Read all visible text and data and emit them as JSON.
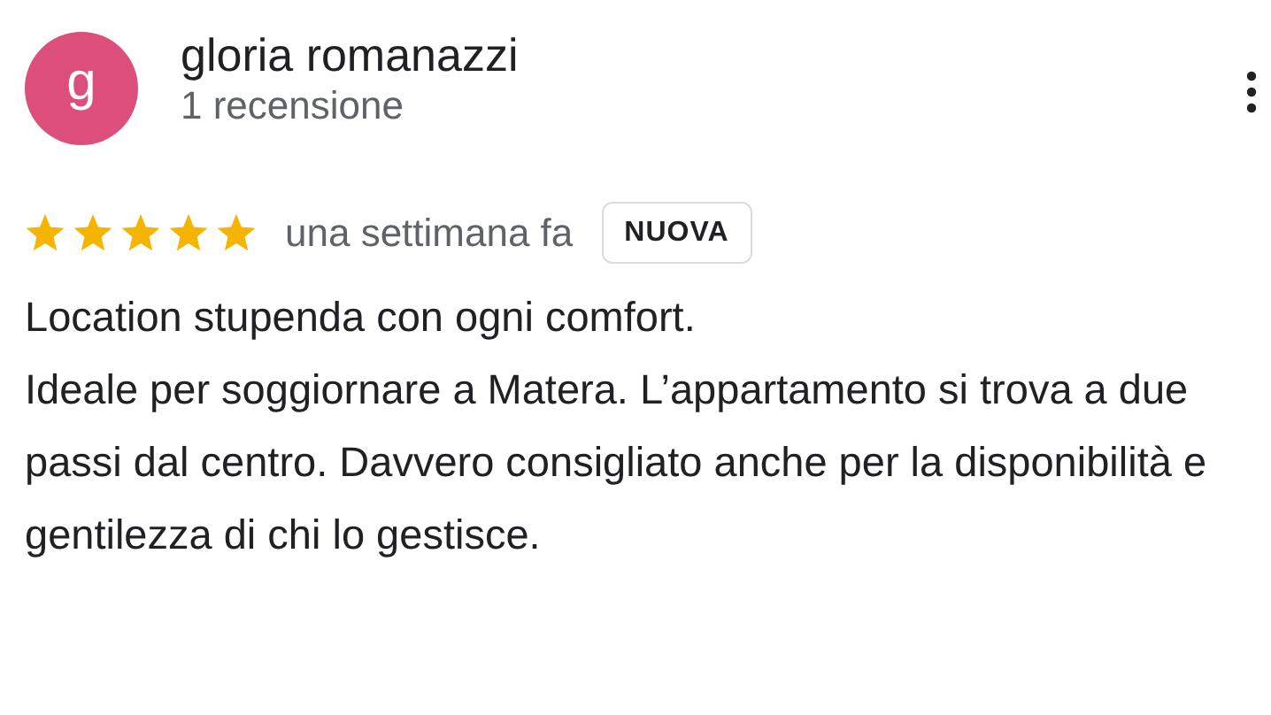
{
  "reviewer": {
    "avatar_letter": "g",
    "name": "gloria romanazzi",
    "review_count": "1 recensione"
  },
  "review": {
    "stars": 5,
    "date": "una settimana fa",
    "badge": "NUOVA",
    "text": "Location stupenda con ogni comfort.\nIdeale per soggiornare a Matera. L’appartamento si trova a due passi dal centro. Davvero consigliato anche per la disponibilità e gentilezza di chi lo gestisce."
  }
}
